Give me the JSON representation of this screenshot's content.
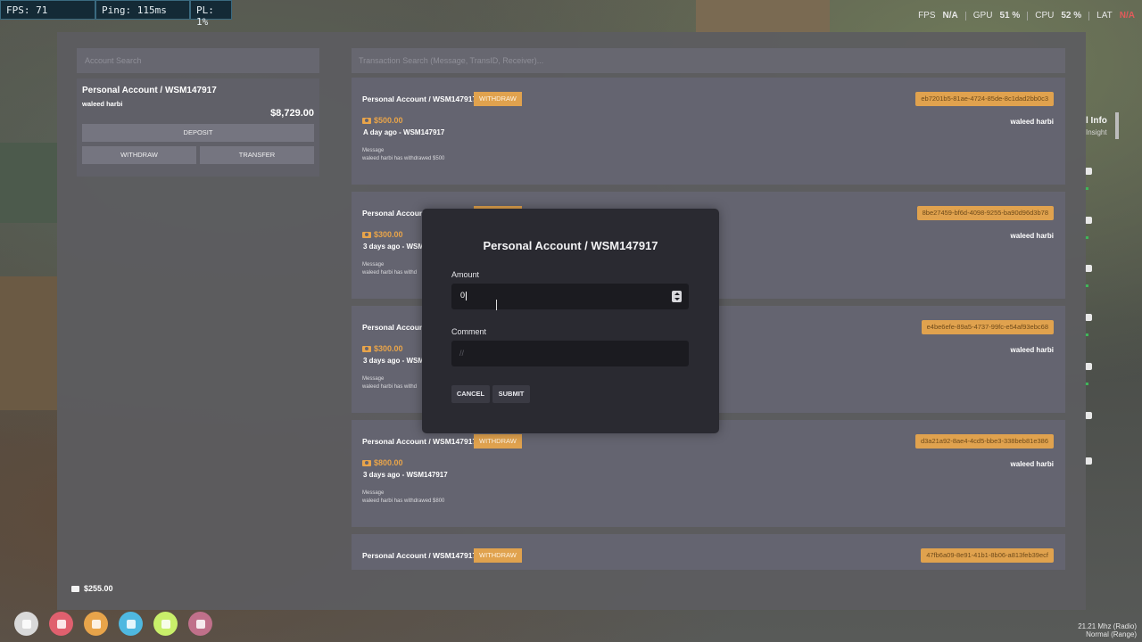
{
  "perf": {
    "fps": "FPS: 71",
    "ping": "Ping: 115ms",
    "pl": "PL: 1%"
  },
  "system": {
    "fps_label": "FPS",
    "fps_value": "N/A",
    "gpu_label": "GPU",
    "gpu_value": "51 %",
    "cpu_label": "CPU",
    "cpu_value": "52 %",
    "lat_label": "LAT",
    "lat_value": "N/A"
  },
  "account_search": {
    "placeholder": "Account Search"
  },
  "account": {
    "title": "Personal Account / WSM147917",
    "owner": "waleed harbi",
    "balance": "$8,729.00",
    "deposit_label": "DEPOSIT",
    "withdraw_label": "WITHDRAW",
    "transfer_label": "TRANSFER"
  },
  "transaction_search": {
    "placeholder": "Transaction Search (Message, TransID, Receiver)..."
  },
  "transactions": [
    {
      "title": "Personal Account / WSM147917",
      "type": "WITHDRAW",
      "id": "eb7201b5-81ae-4724-85de-8c1dad2bb0c3",
      "amount": "$500.00",
      "time": "A day ago - WSM147917",
      "msg_label": "Message",
      "message": "waleed harbi has withdrawed $500",
      "owner": "waleed harbi"
    },
    {
      "title": "Personal Account",
      "type": "WITHDRAW",
      "id": "8be27459-bf6d-4098-9255-ba90d96d3b78",
      "amount": "$300.00",
      "time": "3 days ago - WSM",
      "msg_label": "Message",
      "message": "waleed harbi has withd",
      "owner": "waleed harbi"
    },
    {
      "title": "Personal Account",
      "type": "WITHDRAW",
      "id": "e4be6efe-89a5-4737-99fc-e54af93ebc68",
      "amount": "$300.00",
      "time": "3 days ago - WSM",
      "msg_label": "Message",
      "message": "waleed harbi has withd",
      "owner": "waleed harbi"
    },
    {
      "title": "Personal Account / WSM147917",
      "type": "WITHDRAW",
      "id": "d3a21a92-8ae4-4cd5-bbe3-338beb81e386",
      "amount": "$800.00",
      "time": "3 days ago - WSM147917",
      "msg_label": "Message",
      "message": "waleed harbi has withdrawed $800",
      "owner": "waleed harbi"
    },
    {
      "title": "Personal Account / WSM147917",
      "type": "WITHDRAW",
      "id": "47fb6a09-8e91-41b1-8b06-a813feb39ecf",
      "amount": "",
      "time": "",
      "msg_label": "",
      "message": "",
      "owner": ""
    }
  ],
  "modal": {
    "title": "Personal Account / WSM147917",
    "amount_label": "Amount",
    "amount_value": "0",
    "comment_label": "Comment",
    "comment_placeholder": "//",
    "cancel_label": "CANCEL",
    "submit_label": "SUBMIT"
  },
  "side_peek": {
    "title": "l Info",
    "subtitle": "Insight"
  },
  "hud": {
    "cash": "$255.00",
    "radio_line1": "21.21 Mhz (Radio)",
    "radio_line2": "Normal (Range)",
    "icon_colors": [
      "#d9d9d9",
      "#e0606e",
      "#e8a44a",
      "#4fb8e0",
      "#c9ef6a",
      "#c0708a"
    ]
  }
}
